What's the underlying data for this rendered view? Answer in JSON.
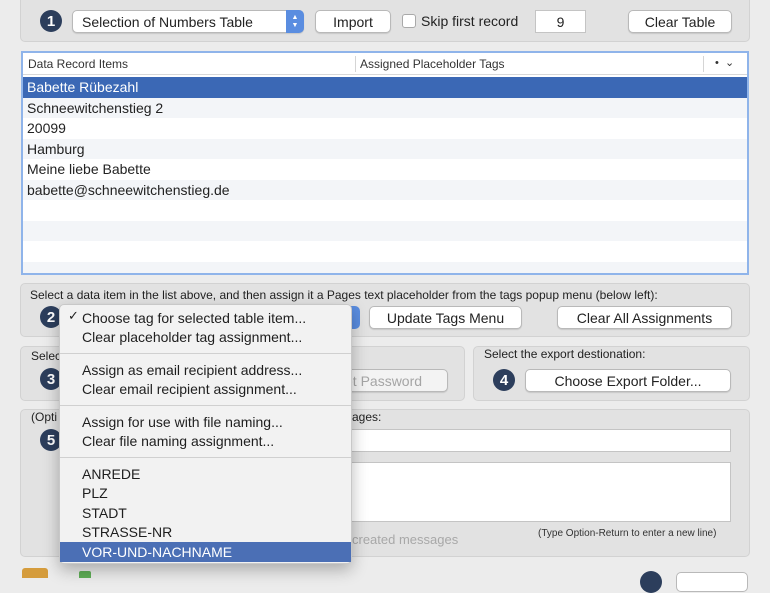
{
  "top": {
    "step1": "1",
    "source_select": "Selection of Numbers Table",
    "import_label": "Import",
    "skip_label": "Skip first record",
    "skip_value": "9",
    "clear_table_label": "Clear Table"
  },
  "table": {
    "col1": "Data Record Items",
    "col2": "Assigned Placeholder Tags",
    "rows": [
      "Babette Rübezahl",
      "Schneewitchenstieg 2",
      "20099",
      "Hamburg",
      "Meine liebe Babette",
      "babette@schneewitchenstieg.de"
    ]
  },
  "assign": {
    "instructions": "Select a data item in the list above, and then assign it a Pages text placeholder from the tags popup menu (below left):",
    "step2": "2",
    "update_tags_label": "Update Tags Menu",
    "clear_all_label": "Clear All Assignments"
  },
  "section3": {
    "label_fragment": "Selec",
    "step3": "3",
    "password_fragment": "et Password"
  },
  "export": {
    "label": "Select the export destionation:",
    "step4": "4",
    "button_label": "Choose Export Folder..."
  },
  "section5": {
    "label_fragment_left": "(Opti",
    "label_fragment_right": "ages:",
    "step5": "5",
    "hint_fragment": "created messages",
    "newline_hint": "(Type Option-Return to enter a new line)"
  },
  "menu": {
    "check_glyph": "✓",
    "items": [
      "Choose tag for selected table item...",
      "Clear placeholder tag assignment...",
      "Assign as email recipient address...",
      "Clear email recipient assignment...",
      "Assign for use with file naming...",
      "Clear file naming assignment...",
      "ANREDE",
      "PLZ",
      "STADT",
      "STRASSE-NR",
      "VOR-UND-NACHNAME"
    ]
  },
  "colors": {
    "accent": "#3b68b5",
    "badge": "#2c3e5c",
    "menu_highlight": "#4b6fb5"
  }
}
